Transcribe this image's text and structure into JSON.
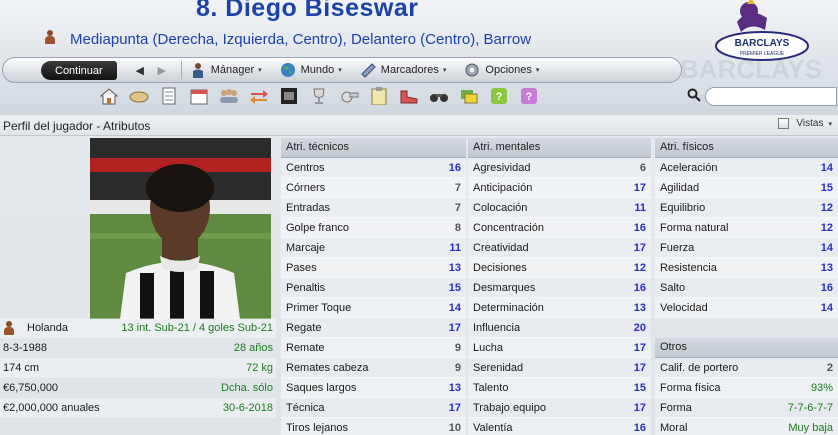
{
  "header": {
    "title": "8. Diego Biseswar",
    "positions": "Mediapunta (Derecha, Izquierda, Centro), Delantero (Centro), Barrow",
    "league_logo_text": "BARCLAYS",
    "league_logo_subtext": "PREMIER LEAGUE"
  },
  "nav": {
    "continue_label": "Continuar",
    "menus": [
      {
        "label": "Mánager",
        "icon": "manager-icon"
      },
      {
        "label": "Mundo",
        "icon": "globe-icon"
      },
      {
        "label": "Marcadores",
        "icon": "scores-icon"
      },
      {
        "label": "Opciones",
        "icon": "options-icon"
      }
    ]
  },
  "toolbar_icons": [
    "home-icon",
    "bread-icon",
    "document-icon",
    "calendar-icon",
    "squad-icon",
    "transfer-arrows-icon",
    "film-icon",
    "trophy-icon",
    "whistle-icon",
    "clipboard-icon",
    "boot-icon",
    "binoculars-icon",
    "cards-icon",
    "help-icon",
    "help-alt-icon"
  ],
  "section": {
    "title": "Perfil del jugador - Atributos",
    "views_label": "Vistas"
  },
  "player_info": [
    {
      "left": "Holanda",
      "right": "13 int. Sub-21 / 4 goles Sub-21",
      "icon": "person-icon"
    },
    {
      "left": "8-3-1988",
      "right": "28 años"
    },
    {
      "left": "174 cm",
      "right": "72 kg"
    },
    {
      "left": "€6,750,000",
      "right": "Dcha. sólo"
    },
    {
      "left": "€2,000,000 anuales",
      "right": "30-6-2018"
    }
  ],
  "technical": {
    "header": "Atri. técnicos",
    "rows": [
      {
        "name": "Centros",
        "value": "16"
      },
      {
        "name": "Córners",
        "value": "7"
      },
      {
        "name": "Entradas",
        "value": "7"
      },
      {
        "name": "Golpe franco",
        "value": "8"
      },
      {
        "name": "Marcaje",
        "value": "11"
      },
      {
        "name": "Pases",
        "value": "13"
      },
      {
        "name": "Penaltis",
        "value": "15"
      },
      {
        "name": "Primer Toque",
        "value": "14"
      },
      {
        "name": "Regate",
        "value": "17"
      },
      {
        "name": "Remate",
        "value": "9"
      },
      {
        "name": "Remates cabeza",
        "value": "9"
      },
      {
        "name": "Saques largos",
        "value": "13"
      },
      {
        "name": "Técnica",
        "value": "17"
      },
      {
        "name": "Tiros lejanos",
        "value": "10"
      }
    ]
  },
  "mental": {
    "header": "Atri. mentales",
    "rows": [
      {
        "name": "Agresividad",
        "value": "6"
      },
      {
        "name": "Anticipación",
        "value": "17"
      },
      {
        "name": "Colocación",
        "value": "11"
      },
      {
        "name": "Concentración",
        "value": "16"
      },
      {
        "name": "Creatividad",
        "value": "17"
      },
      {
        "name": "Decisiones",
        "value": "12"
      },
      {
        "name": "Desmarques",
        "value": "16"
      },
      {
        "name": "Determinación",
        "value": "13"
      },
      {
        "name": "Influencia",
        "value": "20"
      },
      {
        "name": "Lucha",
        "value": "17"
      },
      {
        "name": "Serenidad",
        "value": "17"
      },
      {
        "name": "Talento",
        "value": "15"
      },
      {
        "name": "Trabajo equipo",
        "value": "17"
      },
      {
        "name": "Valentía",
        "value": "16"
      }
    ]
  },
  "physical": {
    "header": "Atri. físicos",
    "rows": [
      {
        "name": "Aceleración",
        "value": "14"
      },
      {
        "name": "Agilidad",
        "value": "15"
      },
      {
        "name": "Equilibrio",
        "value": "12"
      },
      {
        "name": "Forma natural",
        "value": "12"
      },
      {
        "name": "Fuerza",
        "value": "14"
      },
      {
        "name": "Resistencia",
        "value": "13"
      },
      {
        "name": "Salto",
        "value": "16"
      },
      {
        "name": "Velocidad",
        "value": "14"
      }
    ]
  },
  "others": {
    "header": "Otros",
    "rows": [
      {
        "name": "Calif. de portero",
        "value": "2"
      },
      {
        "name": "Forma física",
        "value": "93%"
      },
      {
        "name": "Forma",
        "value": "7-7-6-7-7"
      },
      {
        "name": "Moral",
        "value": "Muy baja"
      }
    ]
  },
  "colors": {
    "accent_blue": "#1b43a8",
    "value_blue": "#2a2fc2",
    "value_green": "#1e7a1e"
  }
}
